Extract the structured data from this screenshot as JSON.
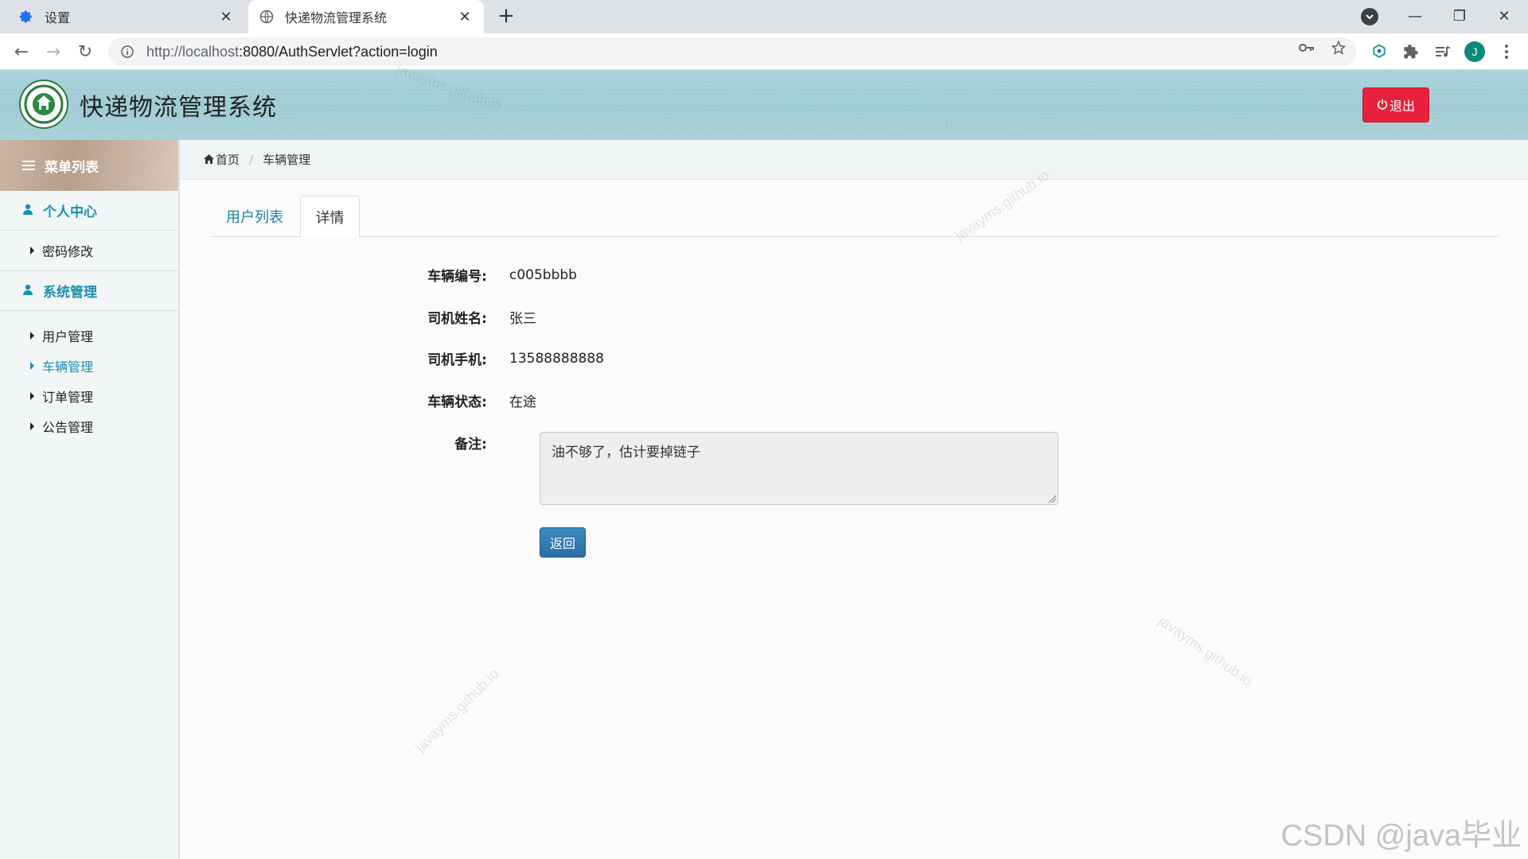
{
  "browser": {
    "tabs": [
      {
        "title": "设置",
        "icon": "gear-icon"
      },
      {
        "title": "快递物流管理系统",
        "icon": "globe-icon"
      }
    ],
    "url_host": "http://localhost",
    "url_rest": ":8080/AuthServlet?action=login",
    "profile_initial": "J"
  },
  "header": {
    "site_title": "快递物流管理系统",
    "logout_label": "退出"
  },
  "sidebar": {
    "menu_title": "菜单列表",
    "groups": [
      {
        "title": "个人中心",
        "items": [
          "密码修改"
        ]
      },
      {
        "title": "系统管理",
        "items": [
          "用户管理",
          "车辆管理",
          "订单管理",
          "公告管理"
        ]
      }
    ]
  },
  "breadcrumb": {
    "home": "首页",
    "current": "车辆管理"
  },
  "tabs": {
    "list": "用户列表",
    "detail": "详情"
  },
  "detail": {
    "fields": [
      {
        "label": "车辆编号:",
        "value": "c005bbbb"
      },
      {
        "label": "司机姓名:",
        "value": "张三"
      },
      {
        "label": "司机手机:",
        "value": "13588888888"
      },
      {
        "label": "车辆状态:",
        "value": "在途"
      }
    ],
    "remark_label": "备注:",
    "remark_value": "油不够了，估计要掉链子",
    "back_label": "返回"
  },
  "watermarks": {
    "text": "javayms.github.io",
    "corner": "CSDN @java毕业"
  },
  "colors": {
    "accent": "#1b8fb0",
    "logout": "#e8213e",
    "back_button": "#2a6fa0"
  }
}
